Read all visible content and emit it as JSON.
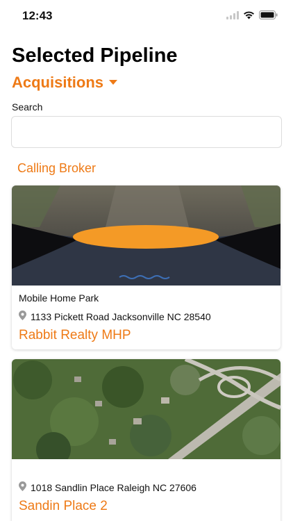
{
  "status_bar": {
    "time": "12:43"
  },
  "page_title": "Selected Pipeline",
  "pipeline": {
    "label": "Acquisitions"
  },
  "search": {
    "label": "Search",
    "value": "",
    "placeholder": ""
  },
  "section": {
    "status_label": "Calling Broker"
  },
  "properties": [
    {
      "type": "Mobile Home Park",
      "address": "1133 Pickett Road Jacksonville NC 28540",
      "name": "Rabbit Realty MHP"
    },
    {
      "type": "",
      "address": "1018 Sandlin Place Raleigh NC 27606",
      "name": "Sandin Place 2"
    }
  ],
  "colors": {
    "accent": "#ee7a16",
    "text": "#111111",
    "border": "#dcdcdc"
  },
  "icons": [
    "cellular-signal-icon",
    "wifi-icon",
    "battery-icon",
    "caret-down-icon",
    "location-pin-icon"
  ]
}
